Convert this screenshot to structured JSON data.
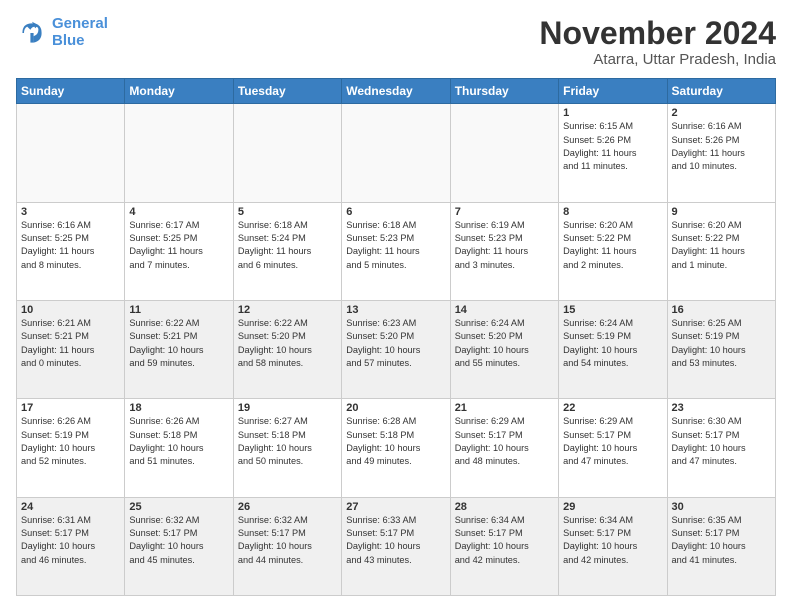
{
  "logo": {
    "line1": "General",
    "line2": "Blue"
  },
  "title": "November 2024",
  "location": "Atarra, Uttar Pradesh, India",
  "weekdays": [
    "Sunday",
    "Monday",
    "Tuesday",
    "Wednesday",
    "Thursday",
    "Friday",
    "Saturday"
  ],
  "weeks": [
    [
      {
        "day": "",
        "detail": ""
      },
      {
        "day": "",
        "detail": ""
      },
      {
        "day": "",
        "detail": ""
      },
      {
        "day": "",
        "detail": ""
      },
      {
        "day": "",
        "detail": ""
      },
      {
        "day": "1",
        "detail": "Sunrise: 6:15 AM\nSunset: 5:26 PM\nDaylight: 11 hours\nand 11 minutes."
      },
      {
        "day": "2",
        "detail": "Sunrise: 6:16 AM\nSunset: 5:26 PM\nDaylight: 11 hours\nand 10 minutes."
      }
    ],
    [
      {
        "day": "3",
        "detail": "Sunrise: 6:16 AM\nSunset: 5:25 PM\nDaylight: 11 hours\nand 8 minutes."
      },
      {
        "day": "4",
        "detail": "Sunrise: 6:17 AM\nSunset: 5:25 PM\nDaylight: 11 hours\nand 7 minutes."
      },
      {
        "day": "5",
        "detail": "Sunrise: 6:18 AM\nSunset: 5:24 PM\nDaylight: 11 hours\nand 6 minutes."
      },
      {
        "day": "6",
        "detail": "Sunrise: 6:18 AM\nSunset: 5:23 PM\nDaylight: 11 hours\nand 5 minutes."
      },
      {
        "day": "7",
        "detail": "Sunrise: 6:19 AM\nSunset: 5:23 PM\nDaylight: 11 hours\nand 3 minutes."
      },
      {
        "day": "8",
        "detail": "Sunrise: 6:20 AM\nSunset: 5:22 PM\nDaylight: 11 hours\nand 2 minutes."
      },
      {
        "day": "9",
        "detail": "Sunrise: 6:20 AM\nSunset: 5:22 PM\nDaylight: 11 hours\nand 1 minute."
      }
    ],
    [
      {
        "day": "10",
        "detail": "Sunrise: 6:21 AM\nSunset: 5:21 PM\nDaylight: 11 hours\nand 0 minutes."
      },
      {
        "day": "11",
        "detail": "Sunrise: 6:22 AM\nSunset: 5:21 PM\nDaylight: 10 hours\nand 59 minutes."
      },
      {
        "day": "12",
        "detail": "Sunrise: 6:22 AM\nSunset: 5:20 PM\nDaylight: 10 hours\nand 58 minutes."
      },
      {
        "day": "13",
        "detail": "Sunrise: 6:23 AM\nSunset: 5:20 PM\nDaylight: 10 hours\nand 57 minutes."
      },
      {
        "day": "14",
        "detail": "Sunrise: 6:24 AM\nSunset: 5:20 PM\nDaylight: 10 hours\nand 55 minutes."
      },
      {
        "day": "15",
        "detail": "Sunrise: 6:24 AM\nSunset: 5:19 PM\nDaylight: 10 hours\nand 54 minutes."
      },
      {
        "day": "16",
        "detail": "Sunrise: 6:25 AM\nSunset: 5:19 PM\nDaylight: 10 hours\nand 53 minutes."
      }
    ],
    [
      {
        "day": "17",
        "detail": "Sunrise: 6:26 AM\nSunset: 5:19 PM\nDaylight: 10 hours\nand 52 minutes."
      },
      {
        "day": "18",
        "detail": "Sunrise: 6:26 AM\nSunset: 5:18 PM\nDaylight: 10 hours\nand 51 minutes."
      },
      {
        "day": "19",
        "detail": "Sunrise: 6:27 AM\nSunset: 5:18 PM\nDaylight: 10 hours\nand 50 minutes."
      },
      {
        "day": "20",
        "detail": "Sunrise: 6:28 AM\nSunset: 5:18 PM\nDaylight: 10 hours\nand 49 minutes."
      },
      {
        "day": "21",
        "detail": "Sunrise: 6:29 AM\nSunset: 5:17 PM\nDaylight: 10 hours\nand 48 minutes."
      },
      {
        "day": "22",
        "detail": "Sunrise: 6:29 AM\nSunset: 5:17 PM\nDaylight: 10 hours\nand 47 minutes."
      },
      {
        "day": "23",
        "detail": "Sunrise: 6:30 AM\nSunset: 5:17 PM\nDaylight: 10 hours\nand 47 minutes."
      }
    ],
    [
      {
        "day": "24",
        "detail": "Sunrise: 6:31 AM\nSunset: 5:17 PM\nDaylight: 10 hours\nand 46 minutes."
      },
      {
        "day": "25",
        "detail": "Sunrise: 6:32 AM\nSunset: 5:17 PM\nDaylight: 10 hours\nand 45 minutes."
      },
      {
        "day": "26",
        "detail": "Sunrise: 6:32 AM\nSunset: 5:17 PM\nDaylight: 10 hours\nand 44 minutes."
      },
      {
        "day": "27",
        "detail": "Sunrise: 6:33 AM\nSunset: 5:17 PM\nDaylight: 10 hours\nand 43 minutes."
      },
      {
        "day": "28",
        "detail": "Sunrise: 6:34 AM\nSunset: 5:17 PM\nDaylight: 10 hours\nand 42 minutes."
      },
      {
        "day": "29",
        "detail": "Sunrise: 6:34 AM\nSunset: 5:17 PM\nDaylight: 10 hours\nand 42 minutes."
      },
      {
        "day": "30",
        "detail": "Sunrise: 6:35 AM\nSunset: 5:17 PM\nDaylight: 10 hours\nand 41 minutes."
      }
    ]
  ]
}
